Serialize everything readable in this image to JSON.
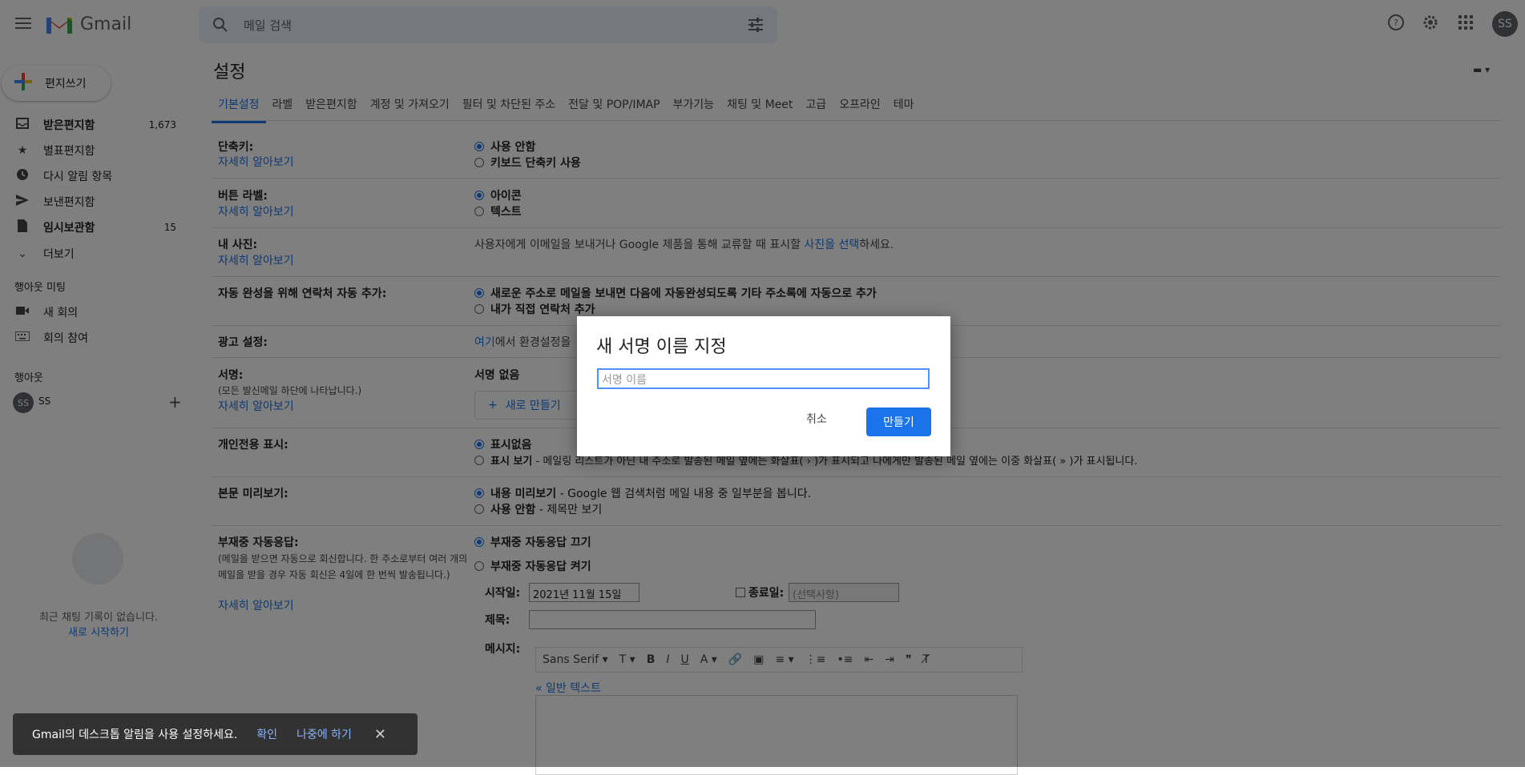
{
  "app": {
    "name": "Gmail",
    "avatar_initials": "SS"
  },
  "search": {
    "placeholder": "메일 검색"
  },
  "sidebar": {
    "compose_label": "편지쓰기",
    "items": [
      {
        "label": "받은편지함",
        "count": "1,673",
        "icon": "inbox-icon",
        "bold": true
      },
      {
        "label": "별표편지함",
        "count": "",
        "icon": "star-icon",
        "bold": false
      },
      {
        "label": "다시 알림 항목",
        "count": "",
        "icon": "clock-icon",
        "bold": false
      },
      {
        "label": "보낸편지함",
        "count": "",
        "icon": "send-icon",
        "bold": false
      },
      {
        "label": "임시보관함",
        "count": "15",
        "icon": "draft-icon",
        "bold": true
      },
      {
        "label": "더보기",
        "count": "",
        "icon": "chevron-down-icon",
        "bold": false
      }
    ],
    "meet_title": "행아웃 미팅",
    "meet_items": [
      {
        "label": "새 회의",
        "icon": "video-icon"
      },
      {
        "label": "회의 참여",
        "icon": "keyboard-icon"
      }
    ],
    "hangouts_title": "행아웃",
    "hangouts_user": "SS",
    "chat_empty_text": "최근 채팅 기록이 없습니다.",
    "chat_start_link": "새로 시작하기"
  },
  "settings": {
    "title": "설정",
    "tabs": [
      "기본설정",
      "라벨",
      "받은편지함",
      "계정 및 가져오기",
      "필터 및 차단된 주소",
      "전달 및 POP/IMAP",
      "부가기능",
      "채팅 및 Meet",
      "고급",
      "오프라인",
      "테마"
    ],
    "learn_more": "자세히 알아보기",
    "shortcuts": {
      "label": "단축키:",
      "opt1": "사용 안함",
      "opt2": "키보드 단축키 사용"
    },
    "button_labels": {
      "label": "버튼 라벨:",
      "opt1": "아이콘",
      "opt2": "텍스트"
    },
    "my_picture": {
      "label": "내 사진:",
      "text_before": "사용자에게 이메일을 보내거나 Google 제품을 통해 교류할 때 표시할 ",
      "link": "사진을 선택",
      "text_after": "하세요."
    },
    "autocomplete": {
      "label": "자동 완성을 위해 연락처 자동 추가:",
      "opt1": "새로운 주소로 메일을 보내면 다음에 자동완성되도록 기타 주소록에 자동으로 추가",
      "opt2": "내가 직접 연락처 추가"
    },
    "ads": {
      "label": "광고 설정:",
      "link": "여기",
      "text": "에서 환경설정을"
    },
    "signature": {
      "label": "서명:",
      "sub": "(모든 발신메일 하단에 나타납니다.)",
      "none": "서명 없음",
      "new_button": "새로 만들기"
    },
    "personal": {
      "label": "개인전용 표시:",
      "opt1": "표시없음",
      "opt2_bold": "표시 보기",
      "opt2_rest": " - 메일링 리스트가 아닌 내 주소로 발송된 메일 옆에는 화살표( › )가 표시되고 나에게만 발송된 메일 옆에는 이중 화살표( » )가 표시됩니다."
    },
    "preview": {
      "label": "본문 미리보기:",
      "opt1_bold": "내용 미리보기",
      "opt1_rest": " - Google 웹 검색처럼 메일 내용 중 일부분을 봅니다.",
      "opt2_bold": "사용 안함",
      "opt2_rest": " - 제목만 보기"
    },
    "vacation": {
      "label": "부재중 자동응답:",
      "sub": "(메일을 받으면 자동으로 회신합니다. 한 주소로부터 여러 개의 메일을 받을 경우 자동 회신은 4일에 한 번씩 발송됩니다.)",
      "opt_off": "부재중 자동응답 끄기",
      "opt_on": "부재중 자동응답 켜기",
      "start_label": "시작일:",
      "start_value": "2021년 11월 15일",
      "end_label": "종료일:",
      "end_placeholder": "(선택사항)",
      "subject_label": "제목:",
      "message_label": "메시지:",
      "font": "Sans Serif",
      "plain_text_link": "« 일반 텍스트"
    }
  },
  "dialog": {
    "title": "새 서명 이름 지정",
    "placeholder": "서명 이름",
    "cancel": "취소",
    "create": "만들기"
  },
  "snackbar": {
    "text": "Gmail의 데스크톱 알림을 사용 설정하세요.",
    "ok": "확인",
    "later": "나중에 하기"
  },
  "colors": {
    "accent": "#1a73e8",
    "overlay": "rgba(0,0,0,0.5)"
  }
}
